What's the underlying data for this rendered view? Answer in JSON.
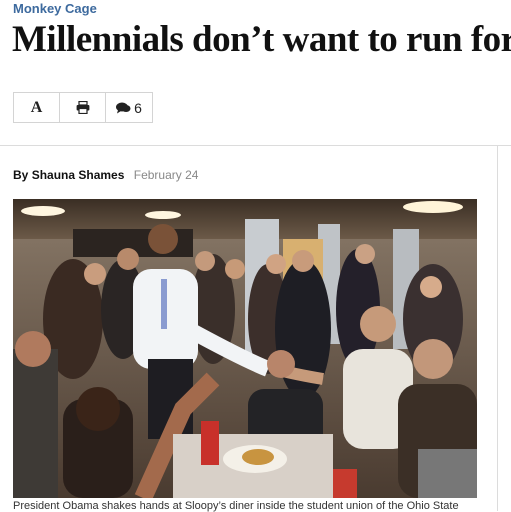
{
  "article": {
    "kicker": "Monkey Cage",
    "headline": "Millennials don’t want to run for",
    "byline_prefix": "By",
    "author": "Shauna Shames",
    "date": "February 24",
    "caption": "President Obama shakes hands at Sloopy’s diner inside the student union of the Ohio State"
  },
  "toolbar": {
    "font_label": "A",
    "print_icon": "print-icon",
    "comments_icon": "comments-icon",
    "comment_count": "6"
  },
  "colors": {
    "kicker": "#3d6a9e",
    "border": "#d4d4d4",
    "date": "#888888"
  }
}
